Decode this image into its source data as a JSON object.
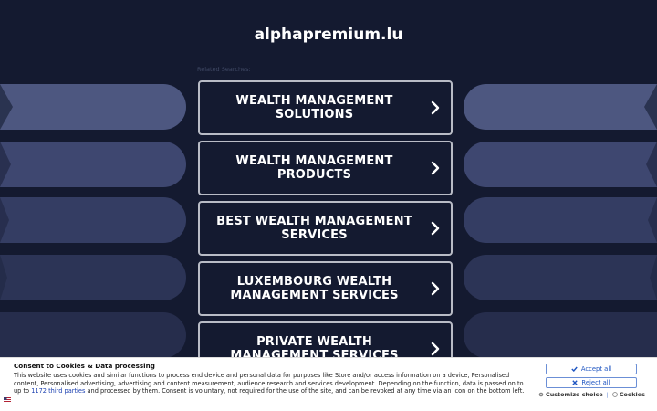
{
  "header": {
    "domain": "alphapremium.lu"
  },
  "related": {
    "label": "Related Searches:"
  },
  "links": [
    {
      "text": "WEALTH MANAGEMENT SOLUTIONS"
    },
    {
      "text": "WEALTH MANAGEMENT PRODUCTS"
    },
    {
      "text": "BEST WEALTH MANAGEMENT SERVICES"
    },
    {
      "text": "LUXEMBOURG WEALTH MANAGEMENT SERVICES"
    },
    {
      "text": "PRIVATE WEALTH MANAGEMENT SERVICES"
    }
  ],
  "consent": {
    "title": "Consent to Cookies & Data processing",
    "text_before": "This website uses cookies and similar functions to process end device and personal data for purposes like Store and/or access information on a device, Personalised content, Personalised advertising, advertising and content measurement, audience research and services development. Depending on the function, data is passed on to up to ",
    "third_parties": "1172 third parties",
    "text_after": " and processed by them. Consent is voluntary, not required for the use of the site, and can be revoked at any time via an icon on the bottom left.",
    "accept_label": "Accept all",
    "reject_label": "Reject all",
    "customize_label": "Customize choice",
    "separator": "|",
    "cookies_label": "Cookies"
  },
  "colors": {
    "background": "#141a30",
    "side_shape": "#4d5780",
    "button_border": "#b9bcc6",
    "consent_accent": "#1f56c2"
  },
  "icons": {
    "link_arrow": "chevron-right-icon",
    "accept": "check-icon",
    "reject": "close-icon",
    "customize": "gear-icon",
    "cookies": "cookie-icon",
    "flag": "flag-icon"
  }
}
